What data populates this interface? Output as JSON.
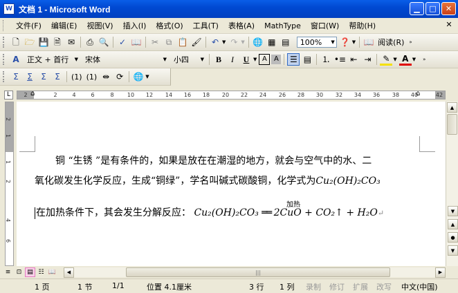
{
  "window": {
    "title": "文档 1 - Microsoft Word",
    "app_icon": "W"
  },
  "menu": [
    "文件(F)",
    "编辑(E)",
    "视图(V)",
    "插入(I)",
    "格式(O)",
    "工具(T)",
    "表格(A)",
    "MathType",
    "窗口(W)",
    "帮助(H)"
  ],
  "toolbar": {
    "zoom": "100%",
    "read_label": "阅读(R)",
    "style": "正文 + 首行",
    "font": "宋体",
    "size": "小四"
  },
  "mathtype_bar": {
    "btn_1": "(1)",
    "btn_2": "(1)"
  },
  "ruler": {
    "h_ticks": [
      "2",
      "2",
      "4",
      "6",
      "8",
      "10",
      "12",
      "14",
      "16",
      "18",
      "20",
      "22",
      "24",
      "26",
      "28",
      "30",
      "32",
      "34",
      "36",
      "38",
      "40",
      "42"
    ],
    "v_ticks": [
      "2",
      "1",
      "1",
      "2",
      "4",
      "6"
    ]
  },
  "document": {
    "line1": "铜 “生锈 ”是有条件的，如果是放在在潮湿的地方，就会与空气中的水、二",
    "line2_text": "氧化碳发生化学反应，生成“铜绿”，学名叫碱式碳酸铜，化学式为",
    "line2_formula": "Cu₂(OH)₂CO₃",
    "line3_text": "在加热条件下，其会发生分解反应：",
    "reaction_left": "Cu₂(OH)₂CO₃",
    "reaction_arrow": "══",
    "reaction_right": "2CuO + CO₂↑ + H₂O",
    "heat_label": "加热",
    "para_mark": "↵"
  },
  "hscroll": {
    "thumb_grip": "|||"
  },
  "status": {
    "page": "1 页",
    "section": "1 节",
    "pages": "1/1",
    "position": "位置 4.1厘米",
    "line": "3 行",
    "column": "1 列",
    "rec": "录制",
    "trk": "修订",
    "ext": "扩展",
    "ovr": "改写",
    "language": "中文(中国)"
  }
}
